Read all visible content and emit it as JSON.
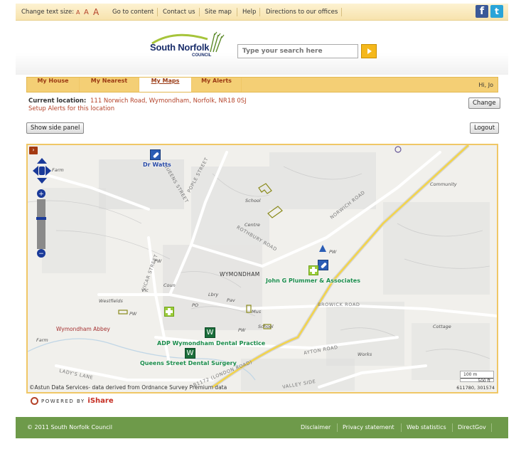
{
  "topbar": {
    "text_size_label": "Change text size:",
    "text_size_options": [
      "A",
      "A",
      "A"
    ],
    "links": [
      "Go to content",
      "Contact us",
      "Site map",
      "Help",
      "Directions to our offices"
    ],
    "social": [
      "facebook-icon",
      "twitter-icon"
    ]
  },
  "header": {
    "logo_title": "South Norfolk",
    "logo_subtitle": "COUNCIL",
    "search_placeholder": "Type your search here"
  },
  "tabs": [
    "My House",
    "My Nearest",
    "My Maps",
    "My Alerts"
  ],
  "active_tab": "My Maps",
  "greeting": "Hi, Jo",
  "location": {
    "label": "Current location:",
    "value": "111 Norwich Road, Wymondham, Norfolk, NR18 0SJ",
    "setup_alerts": "Setup Alerts for this location",
    "change_button": "Change"
  },
  "buttons": {
    "show_side_panel": "Show side panel",
    "logout": "Logout"
  },
  "map": {
    "pois": [
      "Dr Watts",
      "John G Plummer & Associates",
      "ADP Wymondham Dental Practice",
      "Queens Street Dental Surgery"
    ],
    "town": "WYMONDHAM",
    "abbey": "Wymondham Abbey",
    "roads": [
      "NORWICH ROAD",
      "POPLE STREET",
      "VICAR STREET",
      "BROWICK ROAD",
      "AYTON ROAD",
      "B1172 (LONDON ROAD)",
      "LADY'S LANE",
      "VALLEY SIDE",
      "ROTHBURY ROAD",
      "QUEENS STREET"
    ],
    "small_labels": [
      "Farm",
      "School",
      "Centre",
      "PW",
      "Community",
      "Coun",
      "Vic",
      "Lbry",
      "Pav",
      "PO",
      "Mus",
      "School",
      "Westfields",
      "Farm",
      "Works",
      "Cottage",
      "PW",
      "PW",
      "PW"
    ],
    "scale": [
      "100 m",
      "500 ft"
    ],
    "coordinates": "611780, 301574",
    "attribution": "©Astun Data Services- data derived from Ordnance Survey Premium data"
  },
  "powered_by": {
    "prefix": "POWERED BY",
    "brand": "iShare"
  },
  "footer": {
    "copyright": "© 2011 South Norfolk Council",
    "links": [
      "Disclaimer",
      "Privacy statement",
      "Web statistics",
      "DirectGov"
    ]
  },
  "colors": {
    "accent": "#f4cf75",
    "link": "#b5432a",
    "footer": "#6e9a4a",
    "poi_green": "#1a8b4a",
    "poi_blue": "#2547a3"
  }
}
